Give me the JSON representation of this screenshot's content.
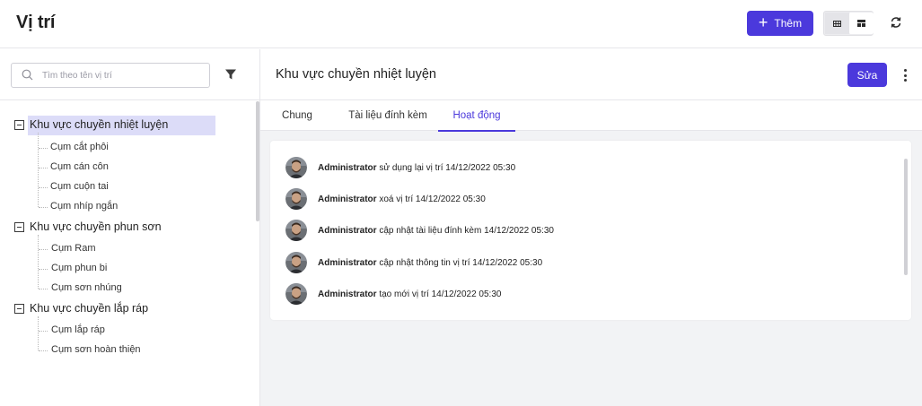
{
  "header": {
    "title": "Vị trí",
    "add_label": "Thêm",
    "add_icon": "plus-icon",
    "view_toggle": [
      "table-view-icon",
      "card-view-icon"
    ],
    "refresh_icon": "refresh-icon",
    "accent_color": "#4b39dc"
  },
  "sidebar": {
    "search_placeholder": "Tìm theo tên vị trí",
    "filter_icon": "filter-icon",
    "tree": [
      {
        "label": "Khu vực chuyền nhiệt luyện",
        "selected": true,
        "children": [
          "Cụm cắt phôi",
          "Cụm cán côn",
          "Cụm cuộn tai",
          "Cụm nhíp ngắn"
        ]
      },
      {
        "label": "Khu vực chuyền phun sơn",
        "selected": false,
        "children": [
          "Cụm Ram",
          "Cụm phun bi",
          "Cụm sơn nhúng"
        ]
      },
      {
        "label": "Khu vực chuyền lắp ráp",
        "selected": false,
        "children": [
          "Cụm lắp ráp",
          "Cụm sơn hoàn thiện"
        ]
      }
    ]
  },
  "detail": {
    "title": "Khu vực chuyền nhiệt luyện",
    "edit_label": "Sửa",
    "more_icon": "more-vertical-icon",
    "tabs": [
      "Chung",
      "Tài liệu đính kèm",
      "Hoạt động"
    ],
    "active_tab": "Hoạt động"
  },
  "activities": [
    {
      "user": "Administrator",
      "action": "sử dụng lại vị trí",
      "time": "14/12/2022 05:30"
    },
    {
      "user": "Administrator",
      "action": "xoá vị trí",
      "time": "14/12/2022 05:30"
    },
    {
      "user": "Administrator",
      "action": "cập nhật tài liệu đính kèm",
      "time": "14/12/2022 05:30"
    },
    {
      "user": "Administrator",
      "action": "cập nhật thông tin vị trí",
      "time": "14/12/2022 05:30"
    },
    {
      "user": "Administrator",
      "action": "tạo mới vị trí",
      "time": "14/12/2022 05:30"
    }
  ]
}
